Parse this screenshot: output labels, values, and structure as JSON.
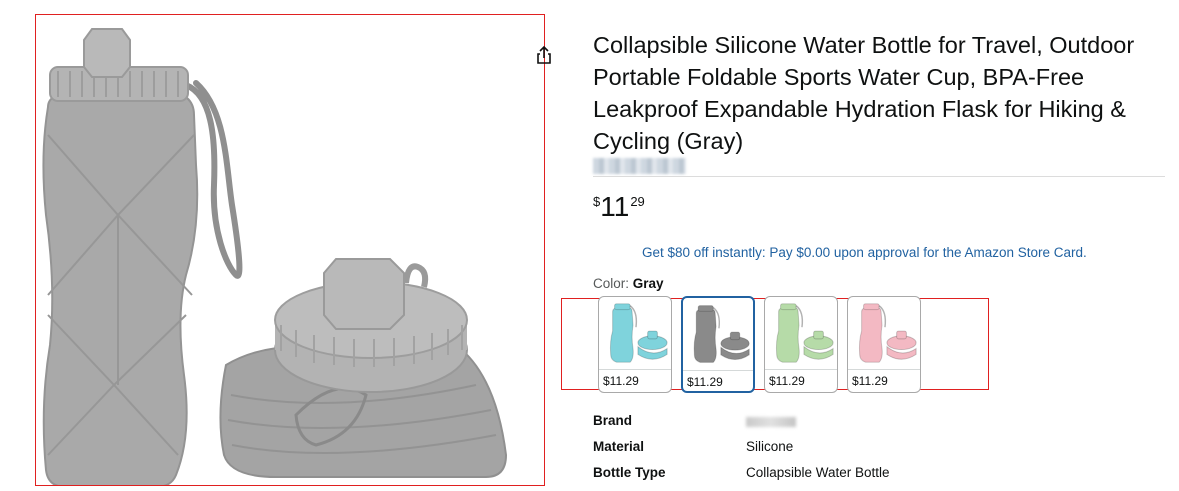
{
  "product": {
    "title": "Collapsible Silicone Water Bottle for Travel, Outdoor Portable Foldable Sports Water Cup, BPA-Free Leakproof Expandable Hydration Flask for Hiking & Cycling (Gray)",
    "price": {
      "symbol": "$",
      "whole": "11",
      "fraction": "29"
    },
    "promo": "Get $80 off instantly: Pay $0.00 upon approval for the Amazon Store Card.",
    "color_label": "Color:",
    "color_value": "Gray"
  },
  "swatches": [
    {
      "price": "$11.29",
      "color": "#7fd3dc",
      "selected": false
    },
    {
      "price": "$11.29",
      "color": "#8a8a8a",
      "selected": true
    },
    {
      "price": "$11.29",
      "color": "#b6dba8",
      "selected": false
    },
    {
      "price": "$11.29",
      "color": "#f3b9c3",
      "selected": false
    }
  ],
  "specs": [
    {
      "key": "Brand",
      "value": ""
    },
    {
      "key": "Material",
      "value": "Silicone"
    },
    {
      "key": "Bottle Type",
      "value": "Collapsible Water Bottle"
    }
  ],
  "icons": {
    "share": "share-icon"
  },
  "colors": {
    "accent_blue": "#2162a1",
    "highlight_red": "#e02020",
    "text": "#0f1111",
    "bottle_gray": "#a6a6a6"
  }
}
